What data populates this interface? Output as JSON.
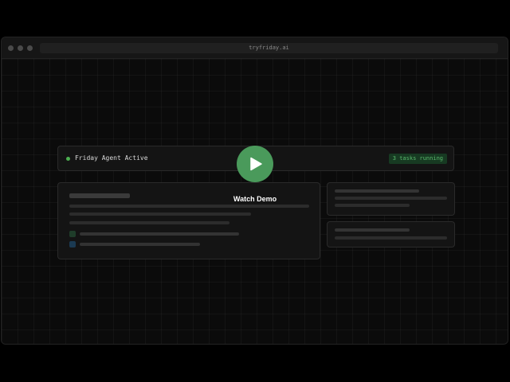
{
  "browser": {
    "url": "tryfriday.ai"
  },
  "status": {
    "label": "Friday Agent Active",
    "badge": "3 tasks running",
    "dot_color": "#4caf50"
  },
  "overlay": {
    "play_icon": "play-icon",
    "label": "Watch Demo",
    "color": "#4a9a5b"
  },
  "colors": {
    "accent_green": "#4caf50",
    "checkbox_green": "#1f3d2a",
    "checkbox_blue": "#1b3a52"
  }
}
